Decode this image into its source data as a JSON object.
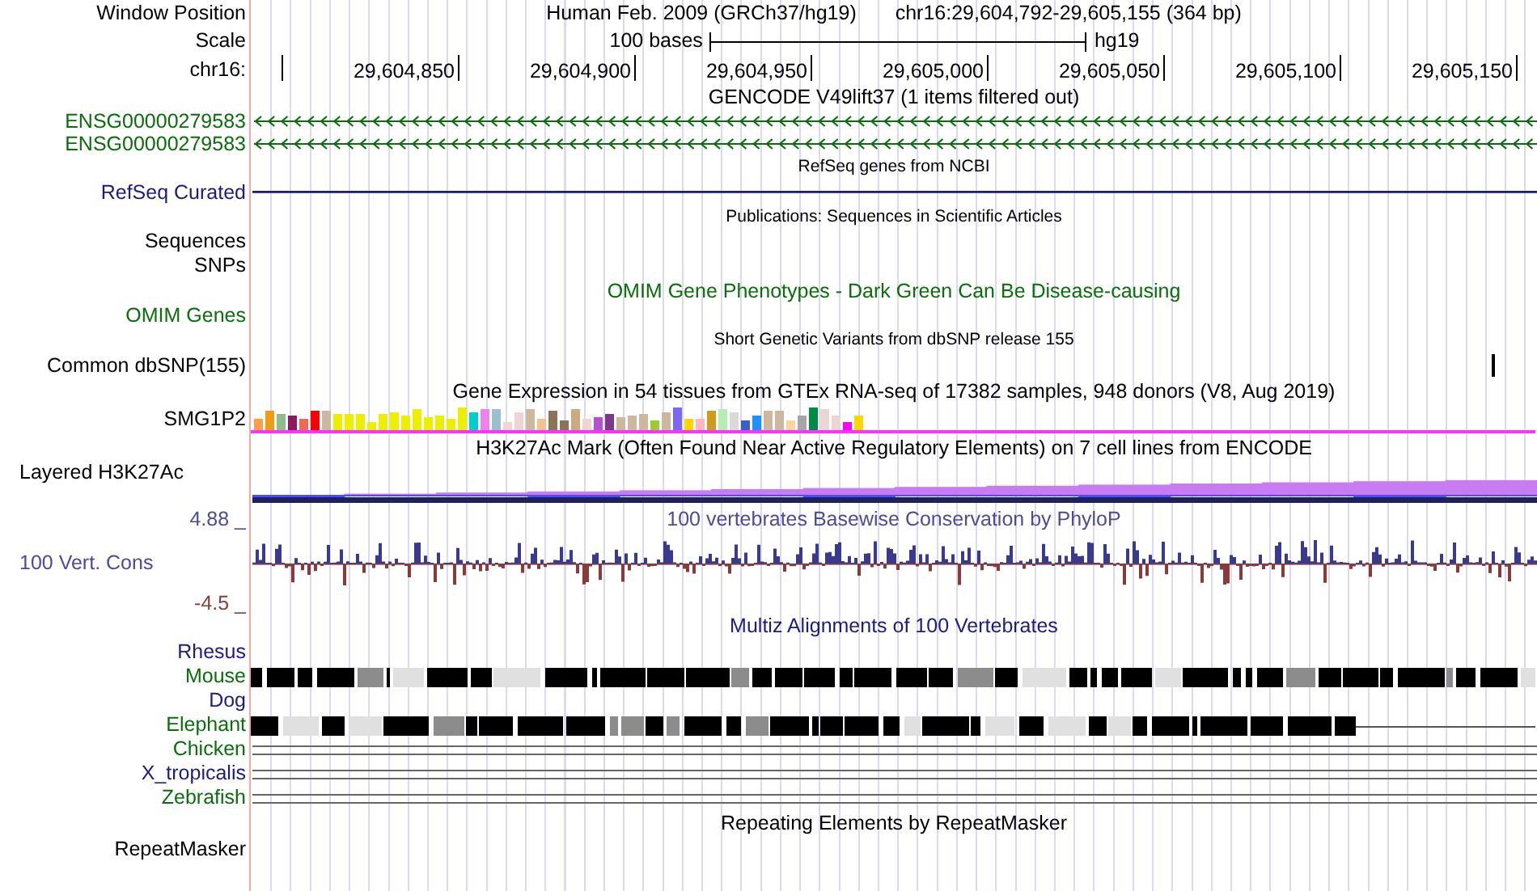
{
  "header": {
    "label": "Window Position",
    "title": "Human Feb. 2009 (GRCh37/hg19)",
    "position": "chr16:29,604,792-29,605,155 (364 bp)"
  },
  "scale": {
    "label": "Scale",
    "text": "100 bases",
    "assembly": "hg19"
  },
  "ruler": {
    "label": "chr16:",
    "ticks": [
      "29,604,850",
      "29,604,900",
      "29,604,950",
      "29,605,000",
      "29,605,050",
      "29,605,100",
      "29,605,150"
    ]
  },
  "rows": [
    {
      "kind": "title",
      "text": "GENCODE V49lift37 (1 items filtered out)",
      "color": "#000000"
    },
    {
      "kind": "gene",
      "label": "ENSG00000279583",
      "color": "#0a6e0a"
    },
    {
      "kind": "gene",
      "label": "ENSG00000279583",
      "color": "#0a6e0a"
    },
    {
      "kind": "note",
      "text": "RefSeq genes from NCBI"
    },
    {
      "kind": "line",
      "label": "RefSeq Curated",
      "color": "#1c1c80"
    },
    {
      "kind": "note",
      "text": "Publications: Sequences in Scientific Articles"
    },
    {
      "kind": "label",
      "label": "Sequences",
      "color": "#000000"
    },
    {
      "kind": "label",
      "label": "SNPs",
      "color": "#000000"
    },
    {
      "kind": "title",
      "text": "OMIM Gene Phenotypes - Dark Green Can Be Disease-causing",
      "color": "#0a6e0a"
    },
    {
      "kind": "label",
      "label": "OMIM Genes",
      "color": "#0a6e0a"
    },
    {
      "kind": "note",
      "text": "Short Genetic Variants from dbSNP release 155"
    },
    {
      "kind": "snp",
      "label": "Common dbSNP(155)",
      "color": "#000000"
    },
    {
      "kind": "title",
      "text": "Gene Expression in 54 tissues from GTEx RNA-seq of 17382 samples, 948 donors (V8, Aug 2019)",
      "color": "#000000"
    },
    {
      "kind": "expression",
      "label": "SMG1P2",
      "color": "#000000"
    },
    {
      "kind": "title",
      "text": "H3K27Ac Mark (Often Found Near Active Regulatory Elements) on 7 cell lines from ENCODE",
      "color": "#000000"
    },
    {
      "kind": "layered",
      "label": "Layered H3K27Ac",
      "color": "#000000"
    },
    {
      "kind": "title",
      "label": "4.88 _",
      "text": "100 vertebrates Basewise Conservation by PhyloP",
      "color": "#4b4b9b"
    },
    {
      "kind": "wiggle",
      "label": "100 Vert. Cons",
      "color": "#4b4b9b",
      "bottom": {
        "text": "-4.5 _",
        "color": "#8b3a3a"
      }
    },
    {
      "kind": "title",
      "text": "Multiz Alignments of 100 Vertebrates",
      "color": "#1c1c80"
    },
    {
      "kind": "label",
      "label": "Rhesus",
      "color": "#1c1c80"
    },
    {
      "kind": "blocks",
      "label": "Mouse",
      "color": "#0a6e0a"
    },
    {
      "kind": "label",
      "label": "Dog",
      "color": "#1c1c80"
    },
    {
      "kind": "partial",
      "label": "Elephant",
      "color": "#0a6e0a"
    },
    {
      "kind": "lines",
      "label": "Chicken",
      "color": "#0a6e0a"
    },
    {
      "kind": "lines",
      "label": "X_tropicalis",
      "color": "#1c1c80"
    },
    {
      "kind": "lines",
      "label": "Zebrafish",
      "color": "#0a6e0a"
    },
    {
      "kind": "title",
      "text": "Repeating Elements by RepeatMasker",
      "color": "#000000"
    },
    {
      "kind": "label",
      "label": "RepeatMasker",
      "color": "#000000"
    }
  ]
}
